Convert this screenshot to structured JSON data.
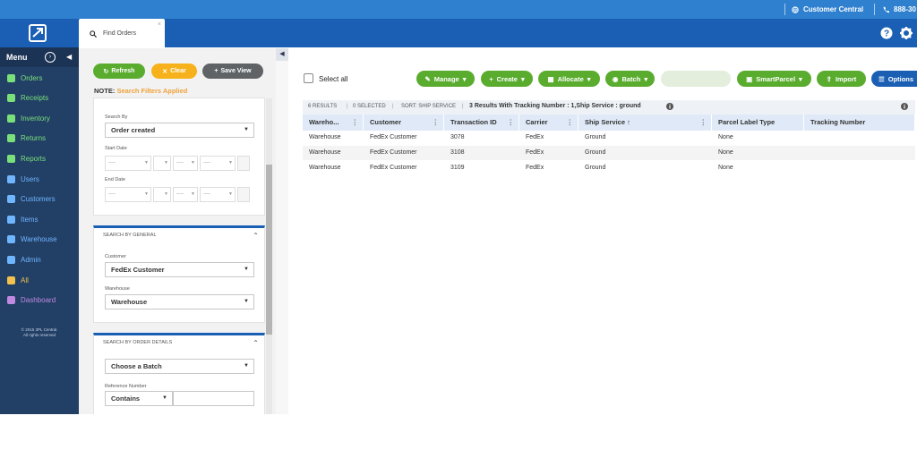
{
  "topbar": {
    "customer_central": "Customer Central",
    "phone": "888-30"
  },
  "tabs": [
    {
      "label": "Find Orders",
      "close": "×"
    }
  ],
  "sidebar": {
    "menu_label": "Menu",
    "items": [
      {
        "label": "Orders",
        "icon": "orders-icon"
      },
      {
        "label": "Receipts",
        "icon": "receipts-icon"
      },
      {
        "label": "Inventory",
        "icon": "inventory-icon"
      },
      {
        "label": "Returns",
        "icon": "returns-icon"
      },
      {
        "label": "Reports",
        "icon": "reports-icon"
      },
      {
        "label": "Users",
        "icon": "users-icon"
      },
      {
        "label": "Customers",
        "icon": "customers-icon"
      },
      {
        "label": "Items",
        "icon": "items-icon"
      },
      {
        "label": "Warehouse",
        "icon": "warehouse-icon"
      },
      {
        "label": "Admin",
        "icon": "admin-icon"
      },
      {
        "label": "All",
        "icon": "all-icon"
      },
      {
        "label": "Dashboard",
        "icon": "dashboard-icon"
      }
    ],
    "item_colors": [
      "#79e07a",
      "#79e07a",
      "#79e07a",
      "#79e07a",
      "#79e07a",
      "#6fb6ff",
      "#6fb6ff",
      "#6fb6ff",
      "#6fb6ff",
      "#6fb6ff",
      "#f2c14e",
      "#c08ae0"
    ],
    "copyright_line1": "© 2015 3PL Central.",
    "copyright_line2": "All rights reserved"
  },
  "filters": {
    "refresh": "Refresh",
    "clear": "Clear",
    "save_view": "Save View",
    "note_prefix": "NOTE:",
    "note_highlight": "Search Filters Applied",
    "search_by_label": "Search By",
    "search_by_value": "Order created",
    "start_date_label": "Start Date",
    "end_date_label": "End Date",
    "date_placeholder": "----",
    "general_header": "Search By General",
    "customer_label": "Customer",
    "customer_value": "FedEx Customer",
    "warehouse_label": "Warehouse",
    "warehouse_value": "Warehouse",
    "order_details_header": "Search By Order Details",
    "batch_value": "Choose a Batch",
    "reference_label": "Reference Number",
    "reference_mode": "Contains"
  },
  "toolbar": {
    "select_all": "Select all",
    "manage": "Manage",
    "create": "Create",
    "allocate": "Allocate",
    "batch": "Batch",
    "smartparcel": "SmartParcel",
    "import": "Import",
    "options": "Options"
  },
  "summary": {
    "results": "6 RESULTS",
    "selected": "0 SELECTED",
    "sort": "SORT: SHIP SERVICE",
    "filter_text": "3 Results With Tracking Number : 1,Ship Service : ground"
  },
  "grid": {
    "columns": [
      "Wareho...",
      "Customer",
      "Transaction ID",
      "Carrier",
      "Ship Service",
      "Parcel Label Type",
      "Tracking Number"
    ],
    "rows": [
      [
        "Warehouse",
        "FedEx Customer",
        "3078",
        "FedEx",
        "Ground",
        "None",
        ""
      ],
      [
        "Warehouse",
        "FedEx Customer",
        "3108",
        "FedEx",
        "Ground",
        "None",
        ""
      ],
      [
        "Warehouse",
        "FedEx Customer",
        "3109",
        "FedEx",
        "Ground",
        "None",
        ""
      ]
    ]
  },
  "colors": {
    "brand_blue": "#1a5fb4",
    "top_blue": "#2f80cf",
    "green": "#5aac2f",
    "orange": "#f7b21b",
    "gray_btn": "#5f6366",
    "options_blue": "#1a5fb4"
  }
}
